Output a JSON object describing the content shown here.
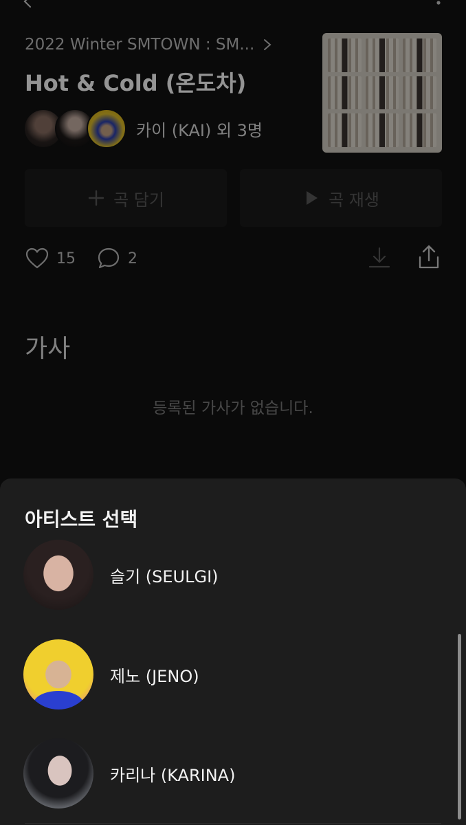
{
  "song": {
    "album_link": "2022 Winter SMTOWN : SM...",
    "title": "Hot & Cold (온도차)",
    "artists_label": "카이 (KAI) 외 3명",
    "add_button_label": "곡 담기",
    "play_button_label": "곡 재생",
    "like_count": "15",
    "comment_count": "2",
    "lyrics_heading": "가사",
    "lyrics_empty": "등록된 가사가 없습니다."
  },
  "icons": {
    "back": "chevron-left-icon",
    "more": "more-icon",
    "album_chevron": "chevron-right-icon",
    "add": "plus-icon",
    "play": "play-icon",
    "like": "heart-icon",
    "comment": "comment-icon",
    "download": "download-icon",
    "share": "share-icon"
  },
  "sheet": {
    "title": "아티스트 선택",
    "artists": [
      {
        "name": "슬기 (SEULGI)"
      },
      {
        "name": "제노 (JENO)"
      },
      {
        "name": "카리나 (KARINA)"
      }
    ]
  },
  "colors": {
    "page_background": "#121212",
    "sheet_background": "#1d1d1d",
    "button_background": "#1b1b1b",
    "primary_text": "#f2f2f2",
    "muted_text": "#7a7a7a"
  }
}
